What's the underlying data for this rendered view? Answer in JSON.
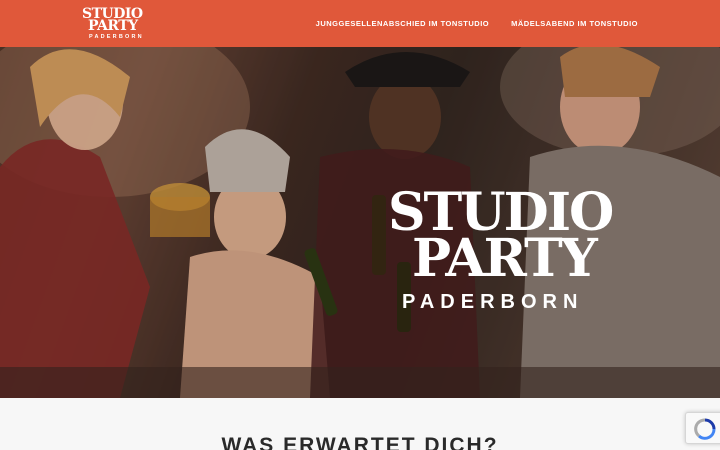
{
  "header": {
    "logo": {
      "line1": "STUDIO",
      "line2": "PARTY",
      "line3": "PADERBORN"
    },
    "nav": [
      {
        "label": "JUNGGESELLENABSCHIED IM TONSTUDIO"
      },
      {
        "label": "MÄDELSABEND IM TONSTUDIO"
      }
    ],
    "bg_color": "#e0583a"
  },
  "hero": {
    "logo": {
      "line1": "STUDIO",
      "line2": "PARTY",
      "line3": "PADERBORN"
    }
  },
  "section": {
    "heading": "WAS ERWARTET DICH?"
  },
  "recaptcha": {
    "icon": "recaptcha-icon"
  }
}
